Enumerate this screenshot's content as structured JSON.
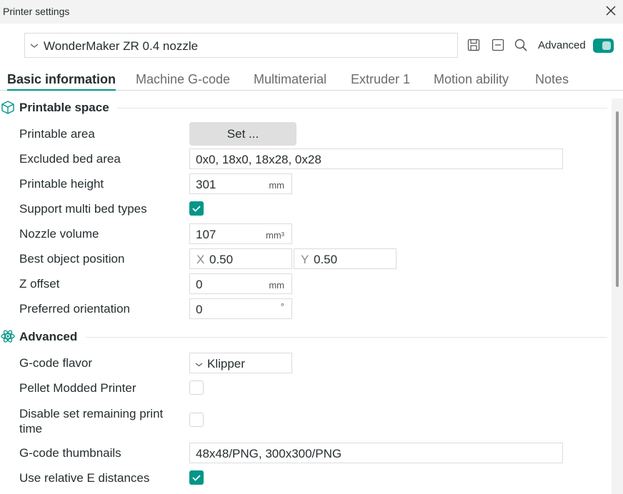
{
  "window": {
    "title": "Printer settings"
  },
  "preset": {
    "value": "WonderMaker ZR 0.4 nozzle"
  },
  "toolbar": {
    "advanced_label": "Advanced",
    "advanced_on": true
  },
  "tabs": [
    {
      "label": "Basic information",
      "active": true
    },
    {
      "label": "Machine G-code"
    },
    {
      "label": "Multimaterial"
    },
    {
      "label": "Extruder 1"
    },
    {
      "label": "Motion ability"
    },
    {
      "label": "Notes"
    }
  ],
  "printable_space": {
    "title": "Printable space",
    "printable_area": {
      "label": "Printable area",
      "button": "Set ..."
    },
    "excluded_bed_area": {
      "label": "Excluded bed area",
      "value": "0x0, 18x0, 18x28, 0x28"
    },
    "printable_height": {
      "label": "Printable height",
      "value": "301",
      "unit": "mm"
    },
    "support_multi_bed": {
      "label": "Support multi bed types",
      "checked": true
    },
    "nozzle_volume": {
      "label": "Nozzle volume",
      "value": "107",
      "unit": "mm³"
    },
    "best_object_position": {
      "label": "Best object position",
      "x_axis": "X",
      "x_value": "0.50",
      "y_axis": "Y",
      "y_value": "0.50"
    },
    "z_offset": {
      "label": "Z offset",
      "value": "0",
      "unit": "mm"
    },
    "preferred_orientation": {
      "label": "Preferred orientation",
      "value": "0",
      "unit": "°"
    }
  },
  "advanced": {
    "title": "Advanced",
    "gcode_flavor": {
      "label": "G-code flavor",
      "value": "Klipper"
    },
    "pellet_modded": {
      "label": "Pellet Modded Printer",
      "checked": false
    },
    "disable_remaining_time": {
      "label": "Disable set remaining print time",
      "checked": false
    },
    "gcode_thumbnails": {
      "label": "G-code thumbnails",
      "value": "48x48/PNG, 300x300/PNG"
    },
    "relative_e": {
      "label": "Use relative E distances",
      "checked": true
    }
  },
  "colors": {
    "accent": "#009688",
    "text": "#262e30",
    "muted": "#6b6b6b"
  }
}
